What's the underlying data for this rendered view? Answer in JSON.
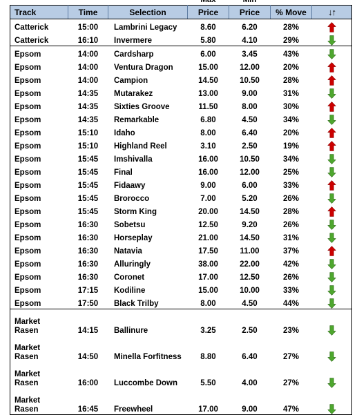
{
  "table": {
    "super_headers": {
      "max": "Max",
      "min": "Min"
    },
    "columns": [
      {
        "key": "track",
        "label": "Track"
      },
      {
        "key": "time",
        "label": "Time"
      },
      {
        "key": "sel",
        "label": "Selection"
      },
      {
        "key": "max",
        "label": "Price"
      },
      {
        "key": "min",
        "label": "Price"
      },
      {
        "key": "move",
        "label": "% Move"
      },
      {
        "key": "arrow",
        "label": "↓↑"
      }
    ],
    "colors": {
      "header_fill": "#b8cce4",
      "header_text": "#000000",
      "grid_line": "#000000",
      "arrow_up": "#cc0000",
      "arrow_down": "#4ea72e",
      "body_text": "#000000",
      "page_background": "#ffffff"
    },
    "rows": [
      {
        "track": "Catterick",
        "time": "15:00",
        "sel": "Lambrini Legacy",
        "max": "8.60",
        "min": "6.20",
        "move": "28%",
        "arrow": "up",
        "group_end": false,
        "tall": false
      },
      {
        "track": "Catterick",
        "time": "16:10",
        "sel": "Invermere",
        "max": "5.80",
        "min": "4.10",
        "move": "29%",
        "arrow": "down",
        "group_end": true,
        "tall": false
      },
      {
        "track": "Epsom",
        "time": "14:00",
        "sel": "Cardsharp",
        "max": "6.00",
        "min": "3.45",
        "move": "43%",
        "arrow": "down",
        "group_end": false,
        "tall": false
      },
      {
        "track": "Epsom",
        "time": "14:00",
        "sel": "Ventura Dragon",
        "max": "15.00",
        "min": "12.00",
        "move": "20%",
        "arrow": "up",
        "group_end": false,
        "tall": false
      },
      {
        "track": "Epsom",
        "time": "14:00",
        "sel": "Campion",
        "max": "14.50",
        "min": "10.50",
        "move": "28%",
        "arrow": "up",
        "group_end": false,
        "tall": false
      },
      {
        "track": "Epsom",
        "time": "14:35",
        "sel": "Mutarakez",
        "max": "13.00",
        "min": "9.00",
        "move": "31%",
        "arrow": "down",
        "group_end": false,
        "tall": false
      },
      {
        "track": "Epsom",
        "time": "14:35",
        "sel": "Sixties Groove",
        "max": "11.50",
        "min": "8.00",
        "move": "30%",
        "arrow": "up",
        "group_end": false,
        "tall": false
      },
      {
        "track": "Epsom",
        "time": "14:35",
        "sel": "Remarkable",
        "max": "6.80",
        "min": "4.50",
        "move": "34%",
        "arrow": "down",
        "group_end": false,
        "tall": false
      },
      {
        "track": "Epsom",
        "time": "15:10",
        "sel": "Idaho",
        "max": "8.00",
        "min": "6.40",
        "move": "20%",
        "arrow": "up",
        "group_end": false,
        "tall": false
      },
      {
        "track": "Epsom",
        "time": "15:10",
        "sel": "Highland Reel",
        "max": "3.10",
        "min": "2.50",
        "move": "19%",
        "arrow": "up",
        "group_end": false,
        "tall": false
      },
      {
        "track": "Epsom",
        "time": "15:45",
        "sel": "Imshivalla",
        "max": "16.00",
        "min": "10.50",
        "move": "34%",
        "arrow": "down",
        "group_end": false,
        "tall": false
      },
      {
        "track": "Epsom",
        "time": "15:45",
        "sel": "Final",
        "max": "16.00",
        "min": "12.00",
        "move": "25%",
        "arrow": "down",
        "group_end": false,
        "tall": false
      },
      {
        "track": "Epsom",
        "time": "15:45",
        "sel": "Fidaawy",
        "max": "9.00",
        "min": "6.00",
        "move": "33%",
        "arrow": "up",
        "group_end": false,
        "tall": false
      },
      {
        "track": "Epsom",
        "time": "15:45",
        "sel": "Brorocco",
        "max": "7.00",
        "min": "5.20",
        "move": "26%",
        "arrow": "down",
        "group_end": false,
        "tall": false
      },
      {
        "track": "Epsom",
        "time": "15:45",
        "sel": "Storm King",
        "max": "20.00",
        "min": "14.50",
        "move": "28%",
        "arrow": "up",
        "group_end": false,
        "tall": false
      },
      {
        "track": "Epsom",
        "time": "16:30",
        "sel": "Sobetsu",
        "max": "12.50",
        "min": "9.20",
        "move": "26%",
        "arrow": "down",
        "group_end": false,
        "tall": false
      },
      {
        "track": "Epsom",
        "time": "16:30",
        "sel": "Horseplay",
        "max": "21.00",
        "min": "14.50",
        "move": "31%",
        "arrow": "down",
        "group_end": false,
        "tall": false
      },
      {
        "track": "Epsom",
        "time": "16:30",
        "sel": "Natavia",
        "max": "17.50",
        "min": "11.00",
        "move": "37%",
        "arrow": "up",
        "group_end": false,
        "tall": false
      },
      {
        "track": "Epsom",
        "time": "16:30",
        "sel": "Alluringly",
        "max": "38.00",
        "min": "22.00",
        "move": "42%",
        "arrow": "down",
        "group_end": false,
        "tall": false
      },
      {
        "track": "Epsom",
        "time": "16:30",
        "sel": "Coronet",
        "max": "17.00",
        "min": "12.50",
        "move": "26%",
        "arrow": "down",
        "group_end": false,
        "tall": false
      },
      {
        "track": "Epsom",
        "time": "17:15",
        "sel": "Kodiline",
        "max": "15.00",
        "min": "10.00",
        "move": "33%",
        "arrow": "down",
        "group_end": false,
        "tall": false
      },
      {
        "track": "Epsom",
        "time": "17:50",
        "sel": "Black Trilby",
        "max": "8.00",
        "min": "4.50",
        "move": "44%",
        "arrow": "down",
        "group_end": true,
        "tall": false
      },
      {
        "track": "Market Rasen",
        "time": "14:15",
        "sel": "Ballinure",
        "max": "3.25",
        "min": "2.50",
        "move": "23%",
        "arrow": "down",
        "group_end": false,
        "tall": true
      },
      {
        "track": "Market Rasen",
        "time": "14:50",
        "sel": "Minella Forfitness",
        "max": "8.80",
        "min": "6.40",
        "move": "27%",
        "arrow": "down",
        "group_end": false,
        "tall": true
      },
      {
        "track": "Market Rasen",
        "time": "16:00",
        "sel": "Luccombe Down",
        "max": "5.50",
        "min": "4.00",
        "move": "27%",
        "arrow": "down",
        "group_end": false,
        "tall": true
      },
      {
        "track": "Market Rasen",
        "time": "16:45",
        "sel": "Freewheel",
        "max": "17.00",
        "min": "9.00",
        "move": "47%",
        "arrow": "down",
        "group_end": true,
        "tall": true
      }
    ]
  }
}
